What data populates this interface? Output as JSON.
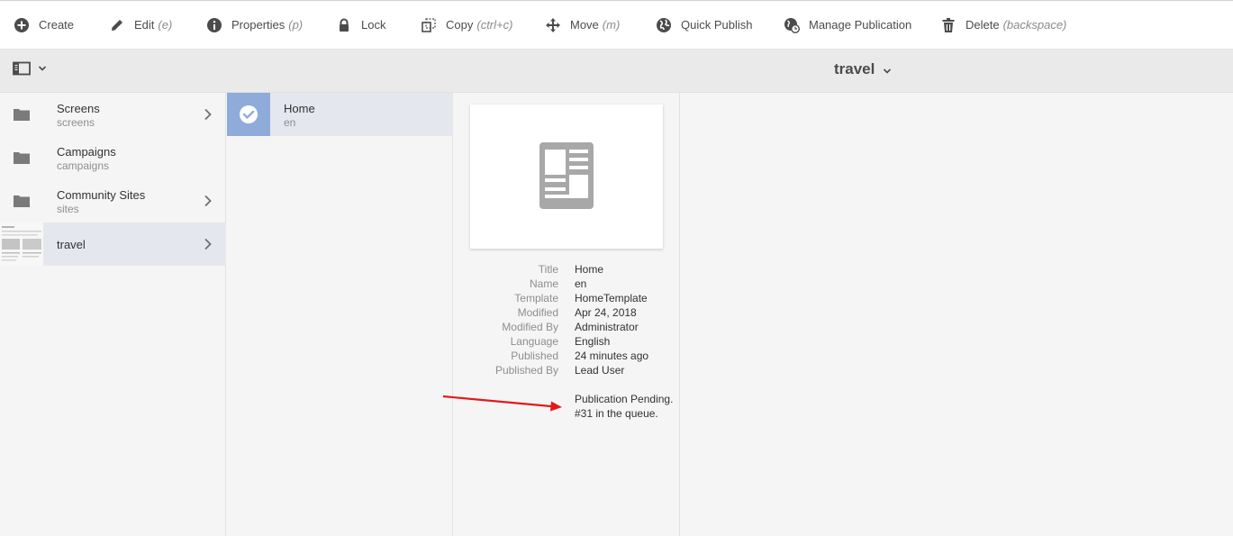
{
  "toolbar": {
    "create": {
      "label": "Create",
      "icon": "plus-circle-icon"
    },
    "edit": {
      "label": "Edit",
      "hint": "(e)",
      "icon": "pencil-icon"
    },
    "properties": {
      "label": "Properties",
      "hint": "(p)",
      "icon": "info-icon"
    },
    "lock": {
      "label": "Lock",
      "icon": "lock-icon"
    },
    "copy": {
      "label": "Copy",
      "hint": "(ctrl+c)",
      "icon": "copy-icon"
    },
    "move": {
      "label": "Move",
      "hint": "(m)",
      "icon": "move-icon"
    },
    "quick_publish": {
      "label": "Quick Publish",
      "icon": "globe-icon"
    },
    "manage_publication": {
      "label": "Manage Publication",
      "icon": "globe-clock-icon"
    },
    "delete": {
      "label": "Delete",
      "hint": "(backspace)",
      "icon": "trash-icon"
    }
  },
  "header": {
    "title": "travel"
  },
  "column1": {
    "items": [
      {
        "title": "Screens",
        "subtitle": "screens",
        "has_children": true
      },
      {
        "title": "Campaigns",
        "subtitle": "campaigns",
        "has_children": false
      },
      {
        "title": "Community Sites",
        "subtitle": "sites",
        "has_children": true
      },
      {
        "title": "travel",
        "subtitle": "",
        "has_children": true,
        "selected": true
      }
    ]
  },
  "column2": {
    "items": [
      {
        "title": "Home",
        "subtitle": "en",
        "selected": true
      }
    ]
  },
  "details": {
    "fields": [
      {
        "key": "Title",
        "value": "Home"
      },
      {
        "key": "Name",
        "value": "en"
      },
      {
        "key": "Template",
        "value": "HomeTemplate"
      },
      {
        "key": "Modified",
        "value": "Apr 24, 2018"
      },
      {
        "key": "Modified By",
        "value": "Administrator"
      },
      {
        "key": "Language",
        "value": "English"
      },
      {
        "key": "Published",
        "value": "24 minutes ago"
      },
      {
        "key": "Published By",
        "value": "Lead User"
      }
    ],
    "status_line1": "Publication Pending.",
    "status_line2": "#31 in the queue."
  },
  "colors": {
    "selected_row": "#e5e7ee",
    "check_thumb": "#8fabda",
    "annotation_arrow": "#e01b1b"
  }
}
